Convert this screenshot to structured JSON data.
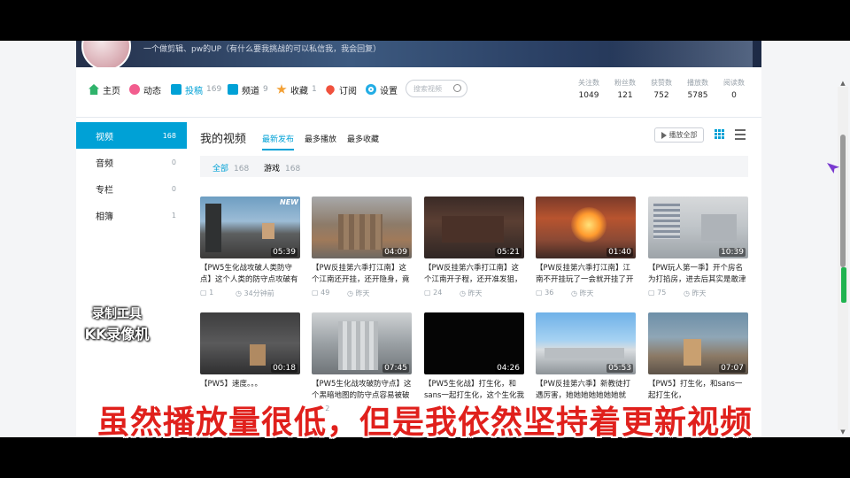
{
  "banner": {
    "intro": "一个做剪辑、pw的UP（有什么要我挑战的可以私信我，我会回复）"
  },
  "nav": {
    "items": [
      {
        "label": "主页",
        "count": "",
        "icon": "home-icon",
        "color": "#2fb36b"
      },
      {
        "label": "动态",
        "count": "",
        "icon": "flower-icon",
        "color": "#f25d8e"
      },
      {
        "label": "投稿",
        "count": "169",
        "icon": "upload-icon",
        "color": "#00a1d6"
      },
      {
        "label": "频道",
        "count": "9",
        "icon": "channel-icon",
        "color": "#00a1d6"
      },
      {
        "label": "收藏",
        "count": "1",
        "icon": "star-icon",
        "color": "#f3a034"
      },
      {
        "label": "订阅",
        "count": "",
        "icon": "heart-icon",
        "color": "#f0513d"
      },
      {
        "label": "设置",
        "count": "",
        "icon": "gear-icon",
        "color": "#23ade5"
      }
    ],
    "search_placeholder": "搜索视频"
  },
  "stats": [
    {
      "label": "关注数",
      "value": "1049"
    },
    {
      "label": "粉丝数",
      "value": "121"
    },
    {
      "label": "获赞数",
      "value": "752"
    },
    {
      "label": "播放数",
      "value": "5785"
    },
    {
      "label": "阅读数",
      "value": "0"
    }
  ],
  "sidebar": [
    {
      "label": "视频",
      "count": "168"
    },
    {
      "label": "音频",
      "count": "0"
    },
    {
      "label": "专栏",
      "count": "0"
    },
    {
      "label": "相簿",
      "count": "1"
    }
  ],
  "main": {
    "title": "我的视频",
    "sorts": [
      "最新发布",
      "最多播放",
      "最多收藏"
    ],
    "play_all": "播放全部",
    "filters": [
      {
        "label": "全部",
        "count": "168"
      },
      {
        "label": "游戏",
        "count": "168"
      }
    ]
  },
  "videos": [
    {
      "duration": "05:39",
      "title": "【PW5生化战攻破人类防守点】这个人类的防守点攻破有",
      "plays": "1",
      "time": "34分钟前",
      "tag": "NEW"
    },
    {
      "duration": "04:09",
      "title": "【PW反挂第六季打江南】这个江南还开挂，还开隐身，竟",
      "plays": "49",
      "time": "昨天",
      "tag": ""
    },
    {
      "duration": "05:21",
      "title": "【PW反挂第六季打江南】这个江南开子程，还开准发狙，",
      "plays": "24",
      "time": "昨天",
      "tag": ""
    },
    {
      "duration": "01:40",
      "title": "【PW反挂第六季打江南】江南不开挂玩了一会就开挂了开",
      "plays": "36",
      "time": "昨天",
      "tag": ""
    },
    {
      "duration": "10:39",
      "title": "【PW玩人第一季】开个房名为打掐房，进去后其实是敢津",
      "plays": "75",
      "time": "昨天",
      "tag": ""
    },
    {
      "duration": "00:18",
      "title": "【PW5】速度。。。",
      "plays": "",
      "time": "",
      "tag": ""
    },
    {
      "duration": "07:45",
      "title": "【PW5生化战攻破防守点】这个黑暗地图的防守点容易被破",
      "plays": "32",
      "time": "",
      "tag": ""
    },
    {
      "duration": "04:26",
      "title": "【PW5生化战】打生化，和sans一起打生化，这个生化我",
      "plays": "",
      "time": "",
      "tag": ""
    },
    {
      "duration": "05:53",
      "title": "【PW反挂第六季】新教徒打遇厉害，她她她她她她她就",
      "plays": "",
      "time": "",
      "tag": ""
    },
    {
      "duration": "07:07",
      "title": "【PW5】打生化，和sans一起打生化，",
      "plays": "",
      "time": "",
      "tag": ""
    }
  ],
  "watermark": {
    "line1": "录制工具",
    "line2": "KK录像机"
  },
  "subtitle": "虽然播放量很低，但是我依然坚持着更新视频",
  "colors": {
    "accent": "#00a1d6",
    "subtitle": "#e0201c"
  }
}
